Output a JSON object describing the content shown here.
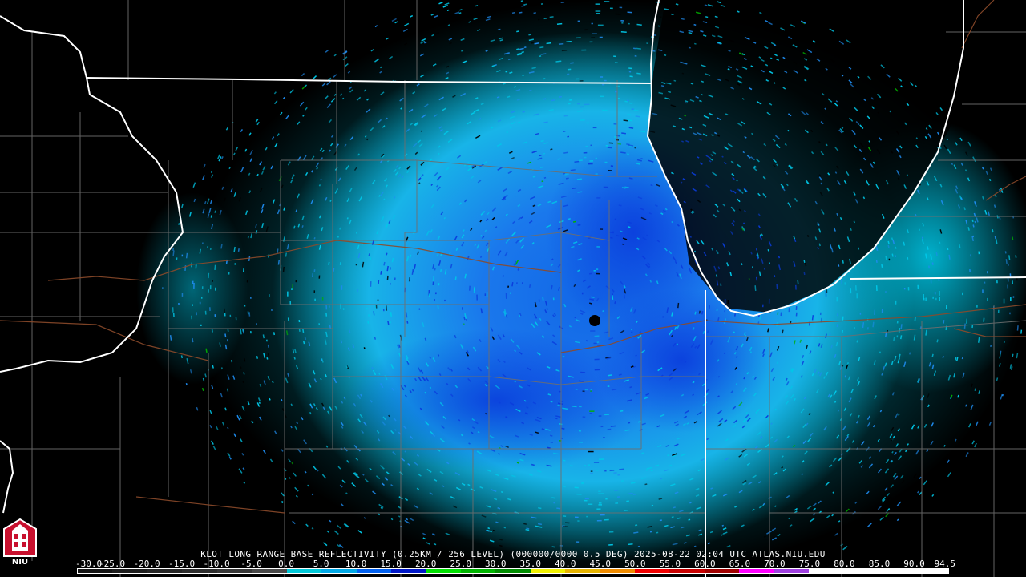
{
  "caption": "KLOT LONG RANGE BASE REFLECTIVITY (0.25KM / 256 LEVEL) (000000/0000 0.5 DEG) 2025-08-22 02:04 UTC  ATLAS.NIU.EDU",
  "logo": {
    "text": "NIU",
    "icon": "university-tower-icon"
  },
  "color_scale": {
    "labels": [
      "-30.0",
      "-25.0",
      "-20.0",
      "-15.0",
      "-10.0",
      "-5.0",
      "0.0",
      "5.0",
      "10.0",
      "15.0",
      "20.0",
      "25.0",
      "30.0",
      "35.0",
      "40.0",
      "45.0",
      "50.0",
      "55.0",
      "60.0",
      "65.0",
      "70.0",
      "75.0",
      "80.0",
      "85.0",
      "90.0",
      "94.5"
    ],
    "colors": [
      "#141414",
      "#1e1e1e",
      "#262626",
      "#2e2e2e",
      "#383838",
      "#4a4a4a",
      "#00c8d8",
      "#00a8e6",
      "#0060f0",
      "#0018c8",
      "#00e000",
      "#00b400",
      "#008c00",
      "#f0f000",
      "#e6b400",
      "#f08c00",
      "#f00000",
      "#c80000",
      "#a00000",
      "#ff00ff",
      "#a040e0",
      "#ffffff",
      "#ffffff",
      "#ffffff",
      "#ffffff"
    ]
  },
  "map": {
    "radar_site": "KLOT",
    "echo_colors": {
      "light": "#00c8e8",
      "medium": "#1e8cf0",
      "heavy": "#0a3cdc",
      "trace": "#00b000"
    },
    "border_color": "#ffffff",
    "county_color": "#6e6e6e",
    "road_color": "#8c4a2a"
  }
}
